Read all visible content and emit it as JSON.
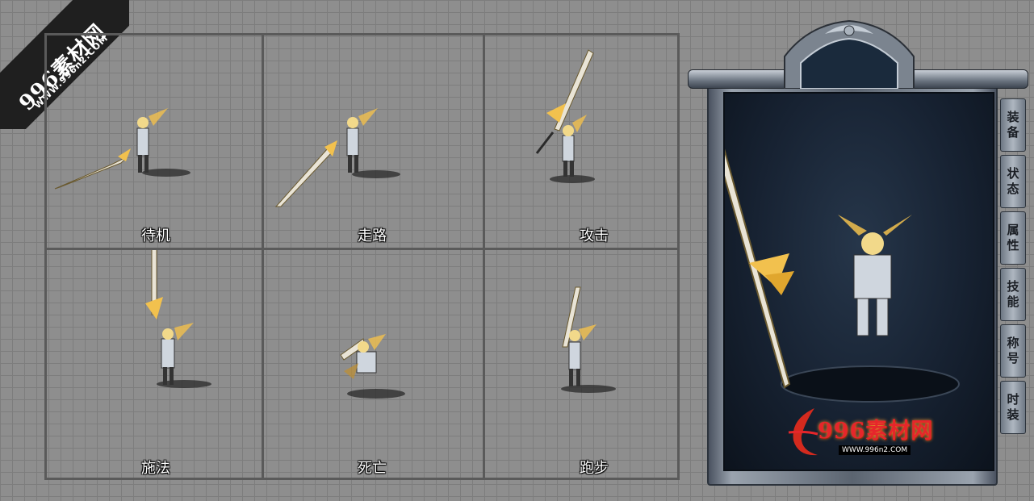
{
  "watermark": {
    "brand": "996素材网",
    "url": "WWW.996n2.COM"
  },
  "frames": [
    {
      "label": "待机"
    },
    {
      "label": "走路"
    },
    {
      "label": "攻击"
    },
    {
      "label": "施法"
    },
    {
      "label": "死亡"
    },
    {
      "label": "跑步"
    }
  ],
  "equipment_panel": {
    "tabs": [
      {
        "label": "装\n备"
      },
      {
        "label": "状\n态"
      },
      {
        "label": "属\n性"
      },
      {
        "label": "技\n能"
      },
      {
        "label": "称\n号"
      },
      {
        "label": "时\n装"
      }
    ],
    "logo_text": "996素材网",
    "logo_url": "WWW.996n2.COM"
  },
  "colors": {
    "grid_bg": "#8e8e8e",
    "grid_line": "#7d7d7d",
    "frame_border": "#5a5a5a",
    "gold": "#f2c14e",
    "logo_red": "#e6262b"
  }
}
